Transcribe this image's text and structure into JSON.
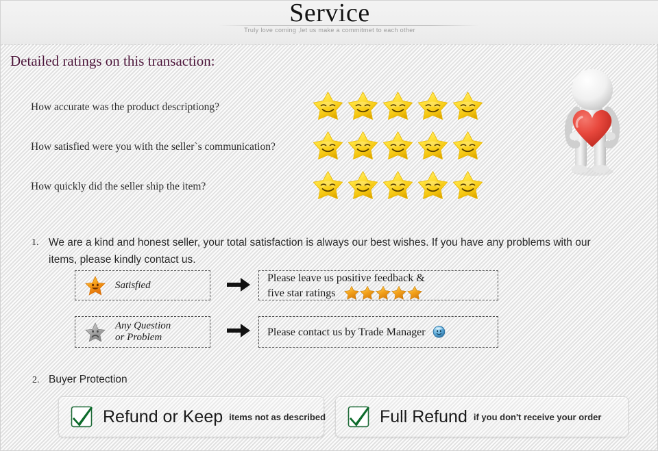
{
  "header": {
    "title": "Service",
    "subtitle": "Truly love coming ,let us make a commitmet to each other",
    "divider_icon": "dashed-divider"
  },
  "ratings": {
    "heading": "Detailed ratings on this transaction:",
    "heading_color": "#4a1338",
    "star_icon": "smiley-star-icon",
    "stars_per_row": 5,
    "rows": [
      {
        "question": "How accurate was the product descriptiong?",
        "stars": 5
      },
      {
        "question": "How satisfied were you with the seller`s communication?",
        "stars": 5
      },
      {
        "question": "How quickly did the seller ship the item?",
        "stars": 5
      }
    ]
  },
  "decoration": {
    "figure_icon": "3d-person-holding-heart-icon",
    "heart_color": "#e8493f",
    "figure_color": "#f2f2f2"
  },
  "items": [
    {
      "number": "1.",
      "text": "We are a kind and honest seller, your total satisfaction is always our best wishes. If you have any problems with our items, please kindly contact us."
    },
    {
      "number": "2.",
      "text": "Buyer Protection"
    }
  ],
  "flows": [
    {
      "left_icon": "happy-star-icon",
      "left_label_line1": "Satisfied",
      "left_label_line2": "",
      "arrow_icon": "arrow-right-icon",
      "right_line1": "Please leave us positive feedback &",
      "right_line2": "five star ratings",
      "right_stars": 5,
      "right_star_icon": "gold-star-icon",
      "right_trailing_icon": ""
    },
    {
      "left_icon": "sad-star-icon",
      "left_label_line1": "Any Question",
      "left_label_line2": "or Problem",
      "arrow_icon": "arrow-right-icon",
      "right_line1": "Please contact us by Trade Manager",
      "right_line2": "",
      "right_stars": 0,
      "right_star_icon": "",
      "right_trailing_icon": "trade-manager-icon"
    }
  ],
  "protection": [
    {
      "icon": "green-checkmark-icon",
      "title": "Refund or Keep",
      "subtitle": "items not as described"
    },
    {
      "icon": "green-checkmark-icon",
      "title": "Full Refund",
      "subtitle": "if you don't receive your order"
    }
  ],
  "colors": {
    "star_yellow": "#f5d515",
    "star_orange": "#f08a1c",
    "check_green": "#0d6b2b",
    "trade_manager_blue": "#4a9fd4"
  }
}
